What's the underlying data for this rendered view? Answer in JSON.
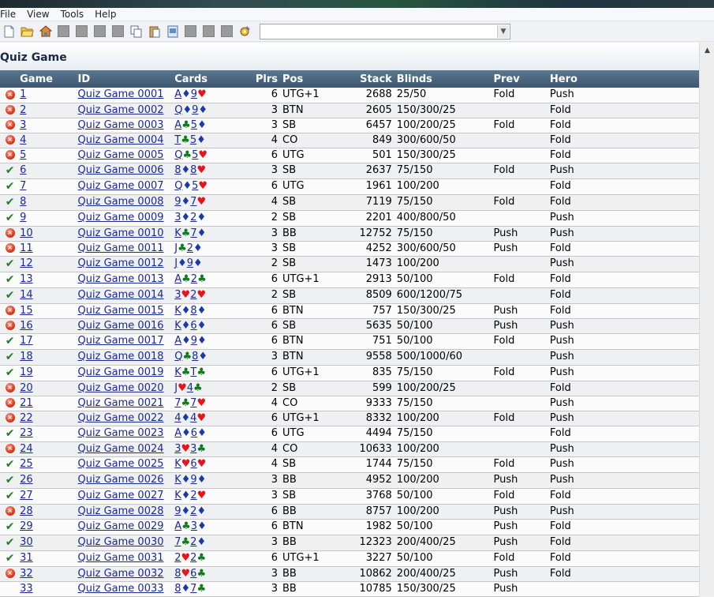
{
  "menu": [
    "File",
    "View",
    "Tools",
    "Help"
  ],
  "toolbar_combo": "",
  "title": "Quiz Game",
  "columns": [
    "Game",
    "ID",
    "Cards",
    "Plrs",
    "Pos",
    "Stack",
    "Blinds",
    "Prev",
    "Hero"
  ],
  "suit_glyphs": {
    "h": "♥",
    "d": "♦",
    "c": "♣",
    "s": "♠"
  },
  "rows": [
    {
      "status": "wrong",
      "game": "1",
      "id": "Quiz Game 0001",
      "cards": [
        [
          "A",
          "d"
        ],
        [
          "9",
          "h"
        ]
      ],
      "plrs": "6",
      "pos": "UTG+1",
      "stack": "2688",
      "blinds": "25/50",
      "prev": "Fold",
      "hero": "Push"
    },
    {
      "status": "wrong",
      "game": "2",
      "id": "Quiz Game 0002",
      "cards": [
        [
          "Q",
          "d"
        ],
        [
          "9",
          "d"
        ]
      ],
      "plrs": "3",
      "pos": "BTN",
      "stack": "2605",
      "blinds": "150/300/25",
      "prev": "",
      "hero": "Fold"
    },
    {
      "status": "wrong",
      "game": "3",
      "id": "Quiz Game 0003",
      "cards": [
        [
          "A",
          "c"
        ],
        [
          "5",
          "d"
        ]
      ],
      "plrs": "3",
      "pos": "SB",
      "stack": "6457",
      "blinds": "100/200/25",
      "prev": "Fold",
      "hero": "Fold"
    },
    {
      "status": "wrong",
      "game": "4",
      "id": "Quiz Game 0004",
      "cards": [
        [
          "T",
          "c"
        ],
        [
          "5",
          "d"
        ]
      ],
      "plrs": "4",
      "pos": "CO",
      "stack": "849",
      "blinds": "300/600/50",
      "prev": "",
      "hero": "Fold"
    },
    {
      "status": "wrong",
      "game": "5",
      "id": "Quiz Game 0005",
      "cards": [
        [
          "Q",
          "c"
        ],
        [
          "5",
          "h"
        ]
      ],
      "plrs": "6",
      "pos": "UTG",
      "stack": "501",
      "blinds": "150/300/25",
      "prev": "",
      "hero": "Fold"
    },
    {
      "status": "ok",
      "game": "6",
      "id": "Quiz Game 0006",
      "cards": [
        [
          "8",
          "d"
        ],
        [
          "8",
          "h"
        ]
      ],
      "plrs": "3",
      "pos": "SB",
      "stack": "2637",
      "blinds": "75/150",
      "prev": "Fold",
      "hero": "Push"
    },
    {
      "status": "ok",
      "game": "7",
      "id": "Quiz Game 0007",
      "cards": [
        [
          "Q",
          "d"
        ],
        [
          "5",
          "h"
        ]
      ],
      "plrs": "6",
      "pos": "UTG",
      "stack": "1961",
      "blinds": "100/200",
      "prev": "",
      "hero": "Fold"
    },
    {
      "status": "ok",
      "game": "8",
      "id": "Quiz Game 0008",
      "cards": [
        [
          "9",
          "d"
        ],
        [
          "7",
          "h"
        ]
      ],
      "plrs": "4",
      "pos": "SB",
      "stack": "7119",
      "blinds": "75/150",
      "prev": "Fold",
      "hero": "Fold"
    },
    {
      "status": "ok",
      "game": "9",
      "id": "Quiz Game 0009",
      "cards": [
        [
          "3",
          "d"
        ],
        [
          "2",
          "d"
        ]
      ],
      "plrs": "2",
      "pos": "SB",
      "stack": "2201",
      "blinds": "400/800/50",
      "prev": "",
      "hero": "Push"
    },
    {
      "status": "wrong",
      "game": "10",
      "id": "Quiz Game 0010",
      "cards": [
        [
          "K",
          "c"
        ],
        [
          "7",
          "d"
        ]
      ],
      "plrs": "3",
      "pos": "BB",
      "stack": "12752",
      "blinds": "75/150",
      "prev": "Push",
      "hero": "Push"
    },
    {
      "status": "wrong",
      "game": "11",
      "id": "Quiz Game 0011",
      "cards": [
        [
          "J",
          "c"
        ],
        [
          "2",
          "d"
        ]
      ],
      "plrs": "3",
      "pos": "SB",
      "stack": "4252",
      "blinds": "300/600/50",
      "prev": "Push",
      "hero": "Fold"
    },
    {
      "status": "ok",
      "game": "12",
      "id": "Quiz Game 0012",
      "cards": [
        [
          "J",
          "d"
        ],
        [
          "9",
          "d"
        ]
      ],
      "plrs": "2",
      "pos": "SB",
      "stack": "1473",
      "blinds": "100/200",
      "prev": "",
      "hero": "Push"
    },
    {
      "status": "ok",
      "game": "13",
      "id": "Quiz Game 0013",
      "cards": [
        [
          "A",
          "c"
        ],
        [
          "2",
          "c"
        ]
      ],
      "plrs": "6",
      "pos": "UTG+1",
      "stack": "2913",
      "blinds": "50/100",
      "prev": "Fold",
      "hero": "Fold"
    },
    {
      "status": "ok",
      "game": "14",
      "id": "Quiz Game 0014",
      "cards": [
        [
          "3",
          "h"
        ],
        [
          "2",
          "h"
        ]
      ],
      "plrs": "2",
      "pos": "SB",
      "stack": "8509",
      "blinds": "600/1200/75",
      "prev": "",
      "hero": "Fold"
    },
    {
      "status": "wrong",
      "game": "15",
      "id": "Quiz Game 0015",
      "cards": [
        [
          "K",
          "d"
        ],
        [
          "8",
          "d"
        ]
      ],
      "plrs": "6",
      "pos": "BTN",
      "stack": "757",
      "blinds": "150/300/25",
      "prev": "Push",
      "hero": "Fold"
    },
    {
      "status": "wrong",
      "game": "16",
      "id": "Quiz Game 0016",
      "cards": [
        [
          "K",
          "d"
        ],
        [
          "6",
          "d"
        ]
      ],
      "plrs": "6",
      "pos": "SB",
      "stack": "5635",
      "blinds": "50/100",
      "prev": "Push",
      "hero": "Push"
    },
    {
      "status": "ok",
      "game": "17",
      "id": "Quiz Game 0017",
      "cards": [
        [
          "A",
          "d"
        ],
        [
          "9",
          "d"
        ]
      ],
      "plrs": "6",
      "pos": "BTN",
      "stack": "751",
      "blinds": "50/100",
      "prev": "Fold",
      "hero": "Push"
    },
    {
      "status": "ok",
      "game": "18",
      "id": "Quiz Game 0018",
      "cards": [
        [
          "Q",
          "c"
        ],
        [
          "8",
          "d"
        ]
      ],
      "plrs": "3",
      "pos": "BTN",
      "stack": "9558",
      "blinds": "500/1000/60",
      "prev": "",
      "hero": "Push"
    },
    {
      "status": "ok",
      "game": "19",
      "id": "Quiz Game 0019",
      "cards": [
        [
          "K",
          "c"
        ],
        [
          "T",
          "c"
        ]
      ],
      "plrs": "6",
      "pos": "UTG+1",
      "stack": "835",
      "blinds": "75/150",
      "prev": "Fold",
      "hero": "Push"
    },
    {
      "status": "wrong",
      "game": "20",
      "id": "Quiz Game 0020",
      "cards": [
        [
          "J",
          "h"
        ],
        [
          "4",
          "c"
        ]
      ],
      "plrs": "2",
      "pos": "SB",
      "stack": "599",
      "blinds": "100/200/25",
      "prev": "",
      "hero": "Fold"
    },
    {
      "status": "wrong",
      "game": "21",
      "id": "Quiz Game 0021",
      "cards": [
        [
          "7",
          "c"
        ],
        [
          "7",
          "h"
        ]
      ],
      "plrs": "4",
      "pos": "CO",
      "stack": "9333",
      "blinds": "75/150",
      "prev": "",
      "hero": "Push"
    },
    {
      "status": "wrong",
      "game": "22",
      "id": "Quiz Game 0022",
      "cards": [
        [
          "4",
          "d"
        ],
        [
          "4",
          "h"
        ]
      ],
      "plrs": "6",
      "pos": "UTG+1",
      "stack": "8332",
      "blinds": "100/200",
      "prev": "Fold",
      "hero": "Push"
    },
    {
      "status": "ok",
      "game": "23",
      "id": "Quiz Game 0023",
      "cards": [
        [
          "A",
          "d"
        ],
        [
          "6",
          "d"
        ]
      ],
      "plrs": "6",
      "pos": "UTG",
      "stack": "4494",
      "blinds": "75/150",
      "prev": "",
      "hero": "Fold"
    },
    {
      "status": "wrong",
      "game": "24",
      "id": "Quiz Game 0024",
      "cards": [
        [
          "3",
          "h"
        ],
        [
          "3",
          "c"
        ]
      ],
      "plrs": "4",
      "pos": "CO",
      "stack": "10633",
      "blinds": "100/200",
      "prev": "",
      "hero": "Push"
    },
    {
      "status": "ok",
      "game": "25",
      "id": "Quiz Game 0025",
      "cards": [
        [
          "K",
          "h"
        ],
        [
          "6",
          "h"
        ]
      ],
      "plrs": "4",
      "pos": "SB",
      "stack": "1744",
      "blinds": "75/150",
      "prev": "Fold",
      "hero": "Push"
    },
    {
      "status": "ok",
      "game": "26",
      "id": "Quiz Game 0026",
      "cards": [
        [
          "K",
          "d"
        ],
        [
          "9",
          "d"
        ]
      ],
      "plrs": "3",
      "pos": "BB",
      "stack": "4952",
      "blinds": "100/200",
      "prev": "Push",
      "hero": "Push"
    },
    {
      "status": "ok",
      "game": "27",
      "id": "Quiz Game 0027",
      "cards": [
        [
          "K",
          "d"
        ],
        [
          "2",
          "h"
        ]
      ],
      "plrs": "3",
      "pos": "SB",
      "stack": "3768",
      "blinds": "50/100",
      "prev": "Fold",
      "hero": "Fold"
    },
    {
      "status": "wrong",
      "game": "28",
      "id": "Quiz Game 0028",
      "cards": [
        [
          "9",
          "d"
        ],
        [
          "2",
          "d"
        ]
      ],
      "plrs": "6",
      "pos": "BB",
      "stack": "8757",
      "blinds": "100/200",
      "prev": "Push",
      "hero": "Push"
    },
    {
      "status": "ok",
      "game": "29",
      "id": "Quiz Game 0029",
      "cards": [
        [
          "A",
          "c"
        ],
        [
          "3",
          "d"
        ]
      ],
      "plrs": "6",
      "pos": "BTN",
      "stack": "1982",
      "blinds": "50/100",
      "prev": "Push",
      "hero": "Fold"
    },
    {
      "status": "ok",
      "game": "30",
      "id": "Quiz Game 0030",
      "cards": [
        [
          "7",
          "c"
        ],
        [
          "2",
          "d"
        ]
      ],
      "plrs": "3",
      "pos": "BB",
      "stack": "12323",
      "blinds": "200/400/25",
      "prev": "Push",
      "hero": "Fold"
    },
    {
      "status": "ok",
      "game": "31",
      "id": "Quiz Game 0031",
      "cards": [
        [
          "2",
          "h"
        ],
        [
          "2",
          "c"
        ]
      ],
      "plrs": "6",
      "pos": "UTG+1",
      "stack": "3227",
      "blinds": "50/100",
      "prev": "Fold",
      "hero": "Fold"
    },
    {
      "status": "wrong",
      "game": "32",
      "id": "Quiz Game 0032",
      "cards": [
        [
          "8",
          "h"
        ],
        [
          "6",
          "c"
        ]
      ],
      "plrs": "3",
      "pos": "BB",
      "stack": "10862",
      "blinds": "200/400/25",
      "prev": "Push",
      "hero": "Fold"
    },
    {
      "status": "none",
      "game": "33",
      "id": "Quiz Game 0033",
      "cards": [
        [
          "8",
          "d"
        ],
        [
          "7",
          "c"
        ]
      ],
      "plrs": "3",
      "pos": "BB",
      "stack": "10785",
      "blinds": "150/300/25",
      "prev": "Push",
      "hero": ""
    }
  ]
}
